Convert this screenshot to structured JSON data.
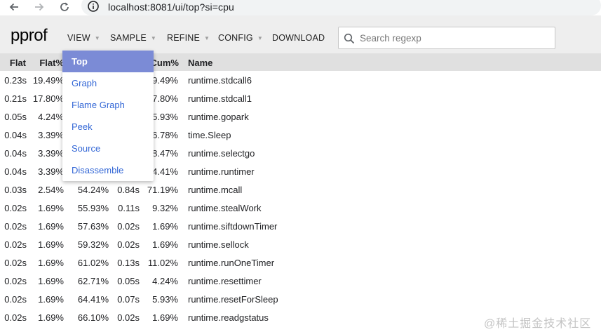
{
  "browser": {
    "url": "localhost:8081/ui/top?si=cpu"
  },
  "app": {
    "logo": "pprof",
    "menu": {
      "view": "VIEW",
      "sample": "SAMPLE",
      "refine": "REFINE",
      "config": "CONFIG",
      "download": "DOWNLOAD"
    },
    "search": {
      "placeholder": "Search regexp",
      "value": ""
    }
  },
  "view_menu": {
    "items": [
      "Top",
      "Graph",
      "Flame Graph",
      "Peek",
      "Source",
      "Disassemble"
    ],
    "selected": "Top"
  },
  "table": {
    "headers": {
      "flat": "Flat",
      "flat_pct": "Flat%",
      "cum_pct": "Cum%",
      "name": "Name"
    },
    "rows": [
      {
        "flat": "0.23s",
        "flat_pct": "19.49%",
        "sum_pct": "",
        "cum": "",
        "cum_pct": "9.49%",
        "name": "runtime.stdcall6"
      },
      {
        "flat": "0.21s",
        "flat_pct": "17.80%",
        "sum_pct": "",
        "cum": "",
        "cum_pct": "7.80%",
        "name": "runtime.stdcall1"
      },
      {
        "flat": "0.05s",
        "flat_pct": "4.24%",
        "sum_pct": "",
        "cum": "",
        "cum_pct": "5.93%",
        "name": "runtime.gopark"
      },
      {
        "flat": "0.04s",
        "flat_pct": "3.39%",
        "sum_pct": "",
        "cum": "",
        "cum_pct": "6.78%",
        "name": "time.Sleep"
      },
      {
        "flat": "0.04s",
        "flat_pct": "3.39%",
        "sum_pct": "",
        "cum": "",
        "cum_pct": "8.47%",
        "name": "runtime.selectgo"
      },
      {
        "flat": "0.04s",
        "flat_pct": "3.39%",
        "sum_pct": "",
        "cum": "",
        "cum_pct": "4.41%",
        "name": "runtime.runtimer"
      },
      {
        "flat": "0.03s",
        "flat_pct": "2.54%",
        "sum_pct": "54.24%",
        "cum": "0.84s",
        "cum_pct": "71.19%",
        "name": "runtime.mcall"
      },
      {
        "flat": "0.02s",
        "flat_pct": "1.69%",
        "sum_pct": "55.93%",
        "cum": "0.11s",
        "cum_pct": "9.32%",
        "name": "runtime.stealWork"
      },
      {
        "flat": "0.02s",
        "flat_pct": "1.69%",
        "sum_pct": "57.63%",
        "cum": "0.02s",
        "cum_pct": "1.69%",
        "name": "runtime.siftdownTimer"
      },
      {
        "flat": "0.02s",
        "flat_pct": "1.69%",
        "sum_pct": "59.32%",
        "cum": "0.02s",
        "cum_pct": "1.69%",
        "name": "runtime.sellock"
      },
      {
        "flat": "0.02s",
        "flat_pct": "1.69%",
        "sum_pct": "61.02%",
        "cum": "0.13s",
        "cum_pct": "11.02%",
        "name": "runtime.runOneTimer"
      },
      {
        "flat": "0.02s",
        "flat_pct": "1.69%",
        "sum_pct": "62.71%",
        "cum": "0.05s",
        "cum_pct": "4.24%",
        "name": "runtime.resettimer"
      },
      {
        "flat": "0.02s",
        "flat_pct": "1.69%",
        "sum_pct": "64.41%",
        "cum": "0.07s",
        "cum_pct": "5.93%",
        "name": "runtime.resetForSleep"
      },
      {
        "flat": "0.02s",
        "flat_pct": "1.69%",
        "sum_pct": "66.10%",
        "cum": "0.02s",
        "cum_pct": "1.69%",
        "name": "runtime.readgstatus"
      }
    ]
  },
  "watermark": "@稀土掘金技术社区"
}
